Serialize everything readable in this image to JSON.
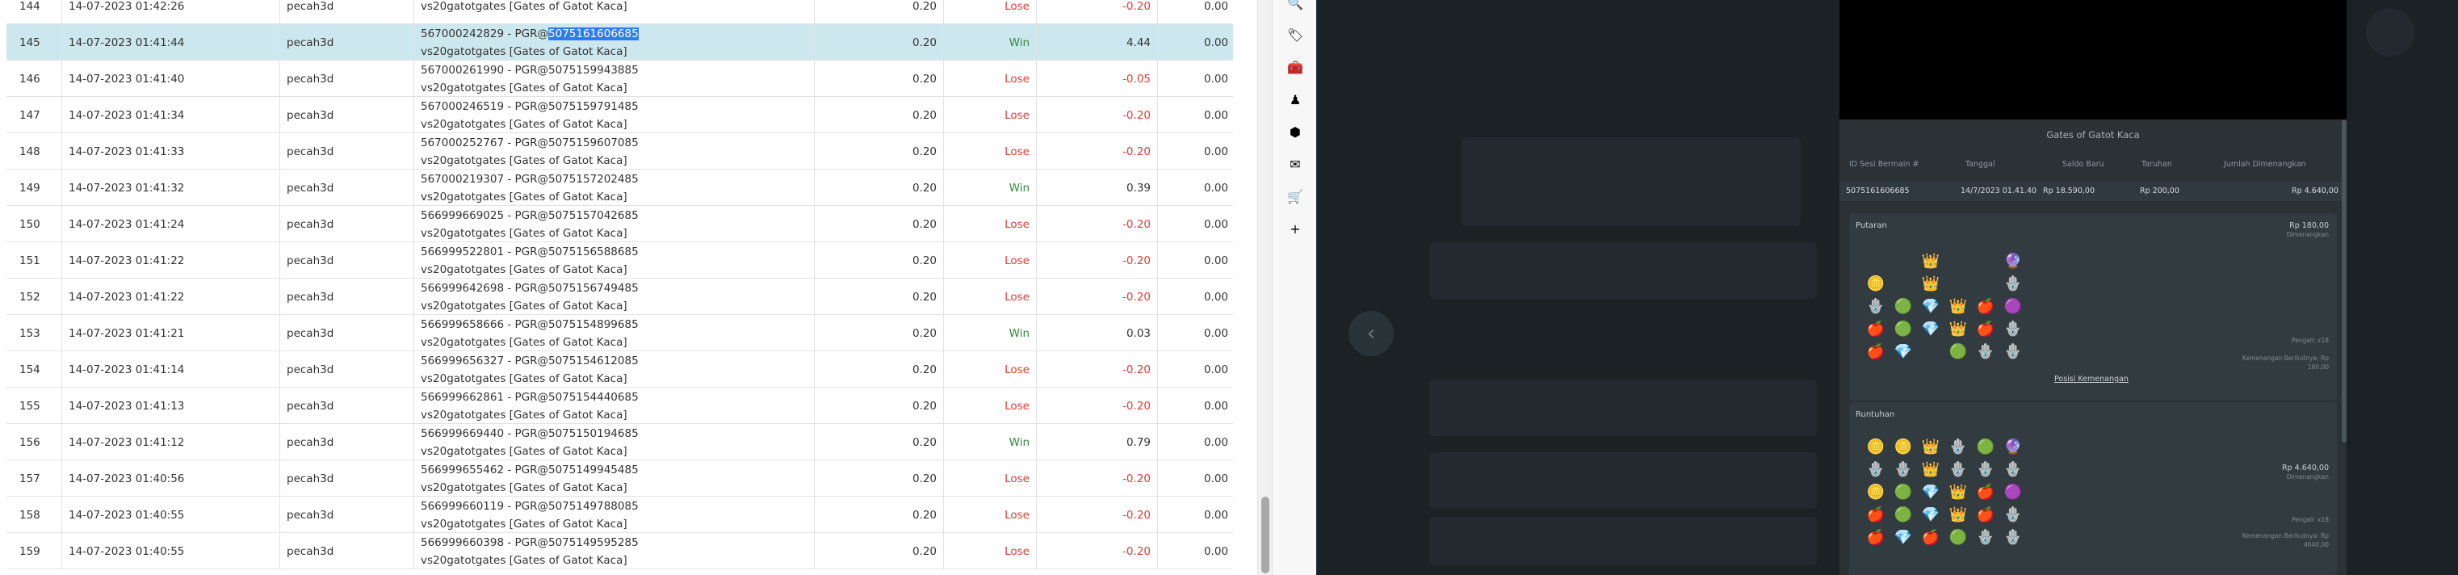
{
  "rows": [
    {
      "num": "144",
      "date": "14-07-2023 01:42:26",
      "user": "pecah3d",
      "txn_prefix": "",
      "txn_sel": "",
      "game": "vs20gatotgates [Gates of Gatot Kaca]",
      "bet": "0.20",
      "result": "Lose",
      "profit": "-0.20",
      "jp": "0.00"
    },
    {
      "num": "145",
      "date": "14-07-2023 01:41:44",
      "user": "pecah3d",
      "txn_prefix": "567000242829 - PGR@",
      "txn_sel": "5075161606685",
      "game": "vs20gatotgates [Gates of Gatot Kaca]",
      "bet": "0.20",
      "result": "Win",
      "profit": "4.44",
      "jp": "0.00"
    },
    {
      "num": "146",
      "date": "14-07-2023 01:41:40",
      "user": "pecah3d",
      "txn_prefix": "567000261990 - PGR@5075159943885",
      "txn_sel": "",
      "game": "vs20gatotgates [Gates of Gatot Kaca]",
      "bet": "0.20",
      "result": "Lose",
      "profit": "-0.05",
      "jp": "0.00"
    },
    {
      "num": "147",
      "date": "14-07-2023 01:41:34",
      "user": "pecah3d",
      "txn_prefix": "567000246519 - PGR@5075159791485",
      "txn_sel": "",
      "game": "vs20gatotgates [Gates of Gatot Kaca]",
      "bet": "0.20",
      "result": "Lose",
      "profit": "-0.20",
      "jp": "0.00"
    },
    {
      "num": "148",
      "date": "14-07-2023 01:41:33",
      "user": "pecah3d",
      "txn_prefix": "567000252767 - PGR@5075159607085",
      "txn_sel": "",
      "game": "vs20gatotgates [Gates of Gatot Kaca]",
      "bet": "0.20",
      "result": "Lose",
      "profit": "-0.20",
      "jp": "0.00"
    },
    {
      "num": "149",
      "date": "14-07-2023 01:41:32",
      "user": "pecah3d",
      "txn_prefix": "567000219307 - PGR@5075157202485",
      "txn_sel": "",
      "game": "vs20gatotgates [Gates of Gatot Kaca]",
      "bet": "0.20",
      "result": "Win",
      "profit": "0.39",
      "jp": "0.00"
    },
    {
      "num": "150",
      "date": "14-07-2023 01:41:24",
      "user": "pecah3d",
      "txn_prefix": "566999669025 - PGR@5075157042685",
      "txn_sel": "",
      "game": "vs20gatotgates [Gates of Gatot Kaca]",
      "bet": "0.20",
      "result": "Lose",
      "profit": "-0.20",
      "jp": "0.00"
    },
    {
      "num": "151",
      "date": "14-07-2023 01:41:22",
      "user": "pecah3d",
      "txn_prefix": "566999522801 - PGR@5075156588685",
      "txn_sel": "",
      "game": "vs20gatotgates [Gates of Gatot Kaca]",
      "bet": "0.20",
      "result": "Lose",
      "profit": "-0.20",
      "jp": "0.00"
    },
    {
      "num": "152",
      "date": "14-07-2023 01:41:22",
      "user": "pecah3d",
      "txn_prefix": "566999642698 - PGR@5075156749485",
      "txn_sel": "",
      "game": "vs20gatotgates [Gates of Gatot Kaca]",
      "bet": "0.20",
      "result": "Lose",
      "profit": "-0.20",
      "jp": "0.00"
    },
    {
      "num": "153",
      "date": "14-07-2023 01:41:21",
      "user": "pecah3d",
      "txn_prefix": "566999658666 - PGR@5075154899685",
      "txn_sel": "",
      "game": "vs20gatotgates [Gates of Gatot Kaca]",
      "bet": "0.20",
      "result": "Win",
      "profit": "0.03",
      "jp": "0.00"
    },
    {
      "num": "154",
      "date": "14-07-2023 01:41:14",
      "user": "pecah3d",
      "txn_prefix": "566999656327 - PGR@5075154612085",
      "txn_sel": "",
      "game": "vs20gatotgates [Gates of Gatot Kaca]",
      "bet": "0.20",
      "result": "Lose",
      "profit": "-0.20",
      "jp": "0.00"
    },
    {
      "num": "155",
      "date": "14-07-2023 01:41:13",
      "user": "pecah3d",
      "txn_prefix": "566999662861 - PGR@5075154440685",
      "txn_sel": "",
      "game": "vs20gatotgates [Gates of Gatot Kaca]",
      "bet": "0.20",
      "result": "Lose",
      "profit": "-0.20",
      "jp": "0.00"
    },
    {
      "num": "156",
      "date": "14-07-2023 01:41:12",
      "user": "pecah3d",
      "txn_prefix": "566999669440 - PGR@5075150194685",
      "txn_sel": "",
      "game": "vs20gatotgates [Gates of Gatot Kaca]",
      "bet": "0.20",
      "result": "Win",
      "profit": "0.79",
      "jp": "0.00"
    },
    {
      "num": "157",
      "date": "14-07-2023 01:40:56",
      "user": "pecah3d",
      "txn_prefix": "566999655462 - PGR@5075149945485",
      "txn_sel": "",
      "game": "vs20gatotgates [Gates of Gatot Kaca]",
      "bet": "0.20",
      "result": "Lose",
      "profit": "-0.20",
      "jp": "0.00"
    },
    {
      "num": "158",
      "date": "14-07-2023 01:40:55",
      "user": "pecah3d",
      "txn_prefix": "566999660119 - PGR@5075149788085",
      "txn_sel": "",
      "game": "vs20gatotgates [Gates of Gatot Kaca]",
      "bet": "0.20",
      "result": "Lose",
      "profit": "-0.20",
      "jp": "0.00"
    },
    {
      "num": "159",
      "date": "14-07-2023 01:40:55",
      "user": "pecah3d",
      "txn_prefix": "566999660398 - PGR@5075149595285",
      "txn_sel": "",
      "game": "vs20gatotgates [Gates of Gatot Kaca]",
      "bet": "0.20",
      "result": "Lose",
      "profit": "-0.20",
      "jp": "0.00"
    }
  ],
  "side_icons": [
    {
      "name": "search-icon",
      "glyph": "🔍"
    },
    {
      "name": "tag-icon",
      "glyph": "🏷"
    },
    {
      "name": "toolbox-icon",
      "glyph": "🧰"
    },
    {
      "name": "chess-icon",
      "glyph": "♟"
    },
    {
      "name": "copilot-icon",
      "glyph": "⬢"
    },
    {
      "name": "outlook-icon",
      "glyph": "✉"
    },
    {
      "name": "cart-icon",
      "glyph": "🛒"
    },
    {
      "name": "add-icon",
      "glyph": "+"
    }
  ],
  "panel": {
    "title": "Gates of Gatot Kaca",
    "headers": [
      "ID Sesi Bermain #",
      "Tanggal",
      "Saldo Baru",
      "Taruhan",
      "Jumlah Dimenangkan"
    ],
    "values": [
      "5075161606685",
      "14/7/2023 01.41.40",
      "Rp 18.590,00",
      "Rp 200,00",
      "Rp 4.640,00"
    ],
    "putaran": {
      "title": "Putaran",
      "amount": "Rp 180,00",
      "sub": "Dimenangkan",
      "note1": "Pengali: x18",
      "note2": "Kemenangan Berikutnya: Rp 180,00",
      "link": "Posisi Kemenangan"
    },
    "runtuhan": {
      "title": "Runtuhan",
      "amount": "Rp 4.640,00",
      "sub": "Dimenangkan",
      "note1": "Pengali: x18",
      "note2": "Kemenangan Berikutnya: Rp 4640,00"
    },
    "grid1": [
      "",
      "",
      "👑",
      "",
      "",
      "🔮",
      "🪙",
      "",
      "👑",
      "",
      "",
      "🪬",
      "🪬",
      "🟢",
      "💎",
      "👑",
      "🍎",
      "🟣",
      "🍎",
      "🟢",
      "💎",
      "👑",
      "🍎",
      "🪬",
      "🍎",
      "💎",
      "",
      "🟢",
      "🪬",
      "🪬"
    ],
    "grid2": [
      "🪙",
      "🪙",
      "👑",
      "🪬",
      "🟢",
      "🔮",
      "🪬",
      "🪬",
      "👑",
      "🪬",
      "🪬",
      "🪬",
      "🪙",
      "🟢",
      "💎",
      "👑",
      "🍎",
      "🟣",
      "🍎",
      "🟢",
      "💎",
      "👑",
      "🍎",
      "🪬",
      "🍎",
      "💎",
      "🍎",
      "🟢",
      "🪬",
      "🪬"
    ]
  },
  "back_glyph": "‹"
}
